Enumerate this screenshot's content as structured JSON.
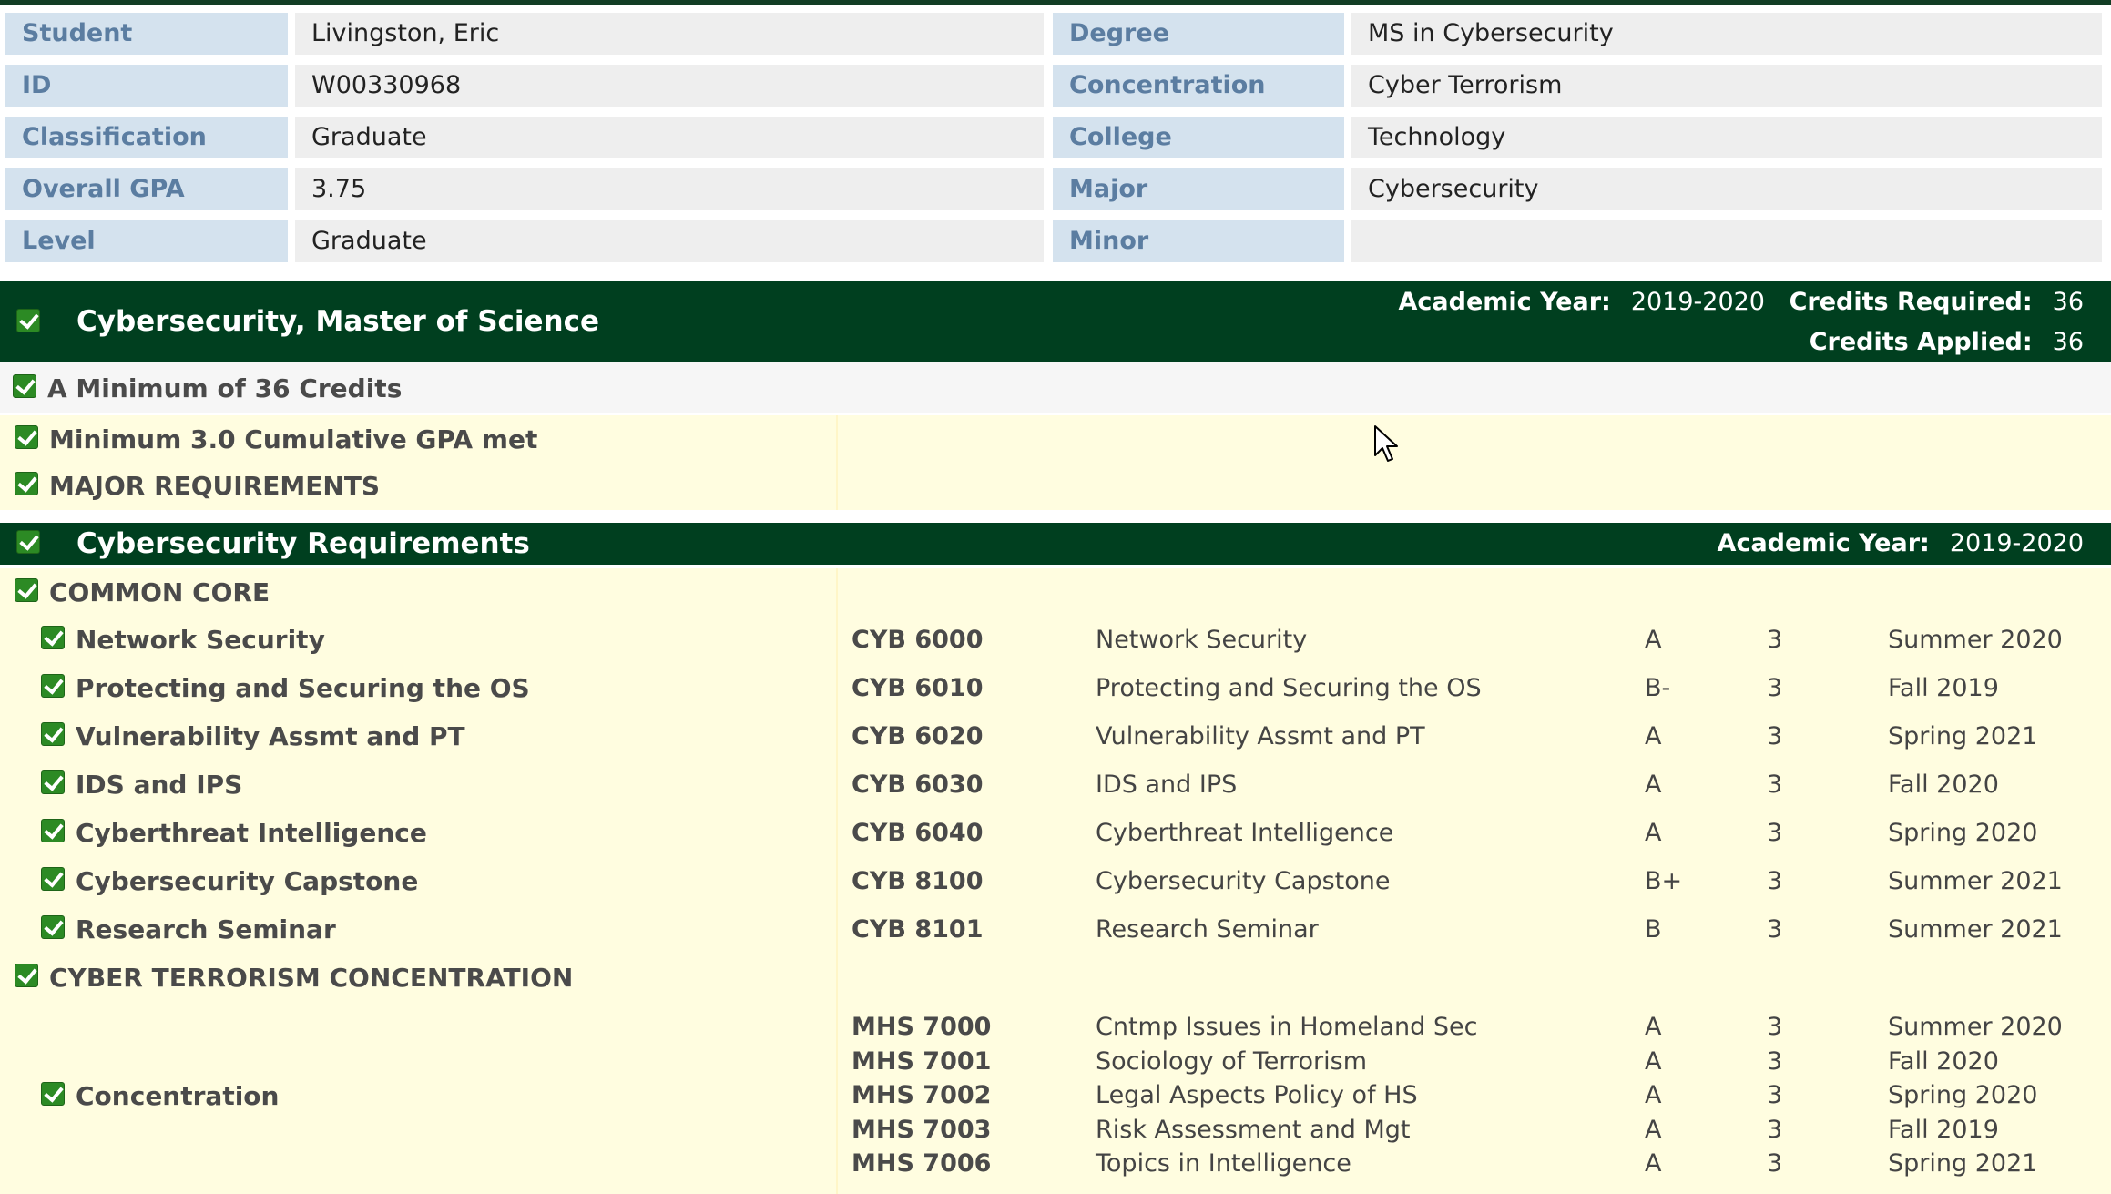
{
  "student_info": [
    {
      "label": "Student",
      "value": "Livingston, Eric",
      "label2": "Degree",
      "value2": "MS in Cybersecurity"
    },
    {
      "label": "ID",
      "value": "W00330968",
      "label2": "Concentration",
      "value2": "Cyber Terrorism"
    },
    {
      "label": "Classification",
      "value": "Graduate",
      "label2": "College",
      "value2": "Technology"
    },
    {
      "label": "Overall GPA",
      "value": "3.75",
      "label2": "Major",
      "value2": "Cybersecurity"
    },
    {
      "label": "Level",
      "value": "Graduate",
      "label2": "Minor",
      "value2": ""
    }
  ],
  "program": {
    "title": "Cybersecurity, Master of Science",
    "academic_year_label": "Academic Year:",
    "academic_year": "2019-2020",
    "credits_required_label": "Credits Required:",
    "credits_required": "36",
    "credits_applied_label": "Credits Applied:",
    "credits_applied": "36"
  },
  "requirements_top": [
    "A Minimum of 36 Credits",
    "Minimum 3.0 Cumulative GPA met",
    "MAJOR REQUIREMENTS"
  ],
  "cyber_req": {
    "title": "Cybersecurity Requirements",
    "academic_year_label": "Academic Year:",
    "academic_year": "2019-2020"
  },
  "common_core": {
    "title": "COMMON CORE",
    "courses": [
      {
        "req": "Network Security",
        "code": "CYB 6000",
        "name": "Network Security",
        "grade": "A",
        "credits": "3",
        "term": "Summer 2020"
      },
      {
        "req": "Protecting and Securing the OS",
        "code": "CYB 6010",
        "name": "Protecting and Securing the OS",
        "grade": "B-",
        "credits": "3",
        "term": "Fall 2019"
      },
      {
        "req": "Vulnerability Assmt and PT",
        "code": "CYB 6020",
        "name": "Vulnerability Assmt and PT",
        "grade": "A",
        "credits": "3",
        "term": "Spring 2021"
      },
      {
        "req": "IDS and IPS",
        "code": "CYB 6030",
        "name": "IDS and IPS",
        "grade": "A",
        "credits": "3",
        "term": "Fall 2020"
      },
      {
        "req": "Cyberthreat Intelligence",
        "code": "CYB 6040",
        "name": "Cyberthreat Intelligence",
        "grade": "A",
        "credits": "3",
        "term": "Spring 2020"
      },
      {
        "req": "Cybersecurity Capstone",
        "code": "CYB 8100",
        "name": "Cybersecurity Capstone",
        "grade": "B+",
        "credits": "3",
        "term": "Summer 2021"
      },
      {
        "req": "Research Seminar",
        "code": "CYB 8101",
        "name": "Research Seminar",
        "grade": "B",
        "credits": "3",
        "term": "Summer 2021"
      }
    ]
  },
  "concentration_block": {
    "title": "CYBER TERRORISM CONCENTRATION",
    "req": "Concentration",
    "courses": [
      {
        "code": "MHS 7000",
        "name": "Cntmp Issues in Homeland Sec",
        "grade": "A",
        "credits": "3",
        "term": "Summer 2020"
      },
      {
        "code": "MHS 7001",
        "name": "Sociology of Terrorism",
        "grade": "A",
        "credits": "3",
        "term": "Fall 2020"
      },
      {
        "code": "MHS 7002",
        "name": "Legal Aspects Policy of HS",
        "grade": "A",
        "credits": "3",
        "term": "Spring 2020"
      },
      {
        "code": "MHS 7003",
        "name": "Risk Assessment and Mgt",
        "grade": "A",
        "credits": "3",
        "term": "Fall 2019"
      },
      {
        "code": "MHS 7006",
        "name": "Topics in Intelligence",
        "grade": "A",
        "credits": "3",
        "term": "Spring 2021"
      }
    ]
  },
  "icons": {
    "check": "checkbox-checked-icon",
    "cursor": "mouse-pointer-icon"
  }
}
